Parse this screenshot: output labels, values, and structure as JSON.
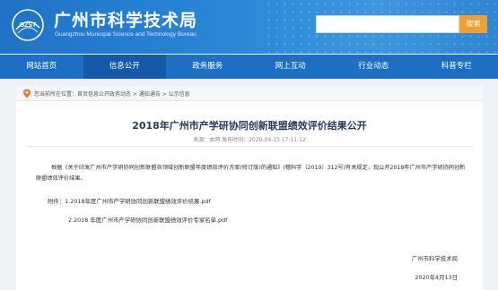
{
  "header": {
    "title": "广州市科学技术局",
    "subtitle": "Guangzhou Municipal Science and Technology Bureau",
    "logo_text": "GZST",
    "search_placeholder": "",
    "search_button": "搜索"
  },
  "nav": {
    "items": [
      {
        "label": "网站首页"
      },
      {
        "label": "信息公开"
      },
      {
        "label": "政务服务"
      },
      {
        "label": "网上互动"
      },
      {
        "label": "行业动态"
      },
      {
        "label": "科普专栏"
      }
    ],
    "active_index": 1
  },
  "breadcrumb": {
    "text": "您当前所在位置：首页信息公开政务动态 > 通知通告 > 公示信息"
  },
  "article": {
    "title": "2018年广州市产学研协同创新联盟绩效评价结果公开",
    "meta": "来源：本网   发布时间：2020-04-13 17:11:12",
    "paragraph": "根据《关于印发广州市产学研协同创新联盟各领域创新联盟年度绩效评价方案(修订版)的通知》(穗科字〔2019〕312号)有关规定，现公开2018年广州市产学研协同创新联盟绩效评价结果。",
    "attachments": [
      "附件：1.2018年度广州市产学研协同创新联盟绩效评价结果.pdf",
      "2.2018 年度广州市产学研协同创新联盟绩效评价专家名单.pdf"
    ],
    "signature": "广州市科学技术局",
    "date": "2020年4月13日"
  },
  "colors": {
    "header_blue": "#2a86d6",
    "nav_blue": "#1c6fc3",
    "nav_active": "#155aa6",
    "search_orange": "#f0a030",
    "title_navy": "#2a3a5c"
  }
}
